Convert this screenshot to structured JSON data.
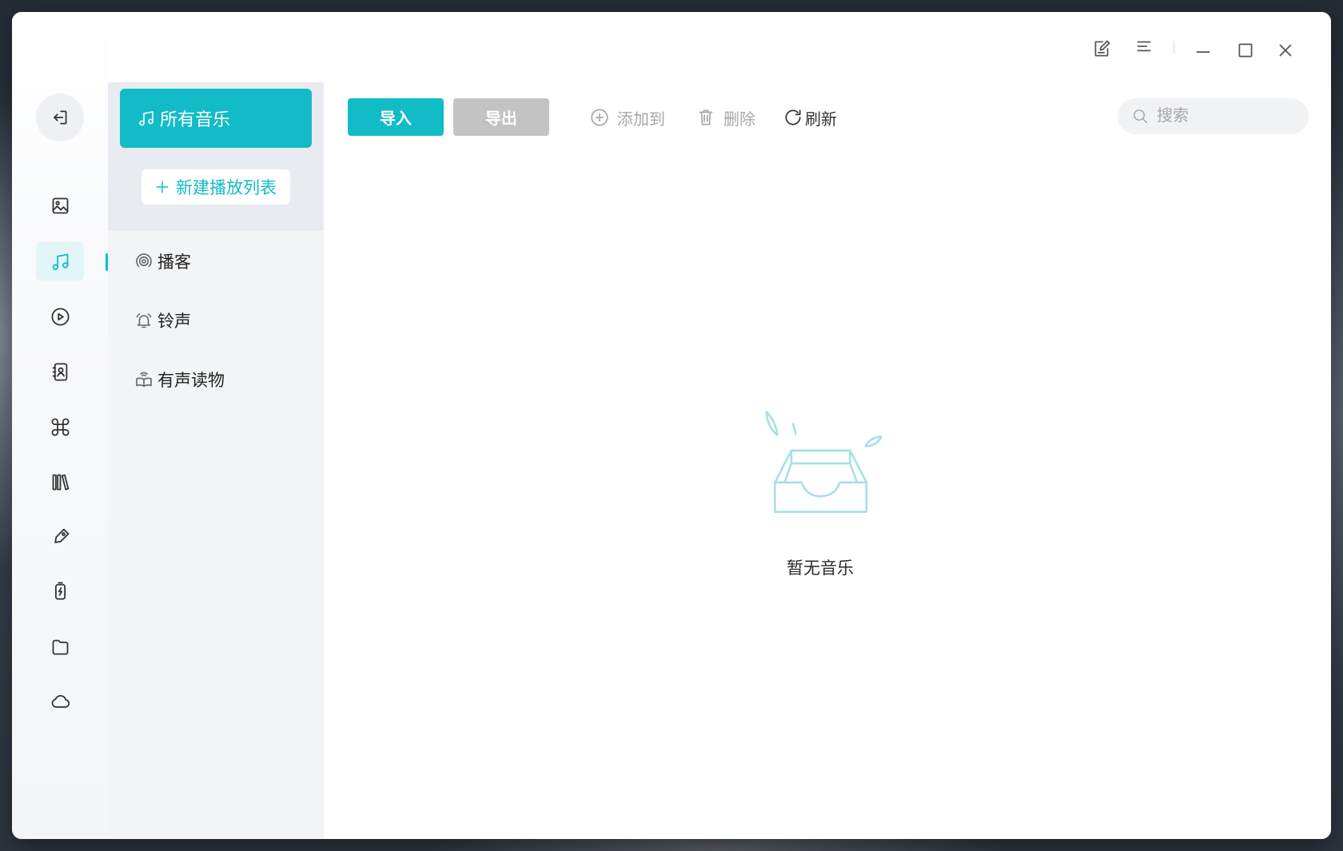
{
  "colors": {
    "accent": "#12bcc7",
    "accent_soft": "#e2f5f7",
    "export_button": "#c3c3c3",
    "muted_text": "#a8a8a8",
    "text": "#2b2b2b",
    "empty_illustration": "#a6e0e6"
  },
  "titlebar": {
    "icons": [
      "feedback-edit-icon",
      "menu-icon",
      "minimize-icon",
      "maximize-icon",
      "close-icon"
    ]
  },
  "rail": {
    "back_icon": "exit-icon",
    "items": [
      {
        "icon": "photo-icon",
        "active": false
      },
      {
        "icon": "music-icon",
        "active": true
      },
      {
        "icon": "video-play-icon",
        "active": false
      },
      {
        "icon": "contacts-icon",
        "active": false
      },
      {
        "icon": "command-icon",
        "active": false
      },
      {
        "icon": "books-icon",
        "active": false
      },
      {
        "icon": "tag-icon",
        "active": false
      },
      {
        "icon": "battery-icon",
        "active": false
      },
      {
        "icon": "folder-icon",
        "active": false
      },
      {
        "icon": "cloud-icon",
        "active": false
      }
    ]
  },
  "sidebar": {
    "all_music": {
      "label": "所有音乐",
      "icon": "music-note-icon",
      "selected": true
    },
    "new_playlist": {
      "label": "新建播放列表",
      "icon": "plus-icon"
    },
    "items": [
      {
        "label": "播客",
        "icon": "podcast-icon"
      },
      {
        "label": "铃声",
        "icon": "bell-icon"
      },
      {
        "label": "有声读物",
        "icon": "audiobook-icon"
      }
    ]
  },
  "toolbar": {
    "import_label": "导入",
    "export_label": "导出",
    "add_to": {
      "label": "添加到",
      "icon": "plus-circle-icon",
      "enabled": false
    },
    "delete": {
      "label": "删除",
      "icon": "trash-icon",
      "enabled": false
    },
    "refresh": {
      "label": "刷新",
      "icon": "refresh-icon",
      "enabled": true
    },
    "search": {
      "placeholder": "搜索",
      "icon": "search-icon"
    }
  },
  "empty_state": {
    "illustration": "empty-box-illustration",
    "message": "暂无音乐"
  }
}
